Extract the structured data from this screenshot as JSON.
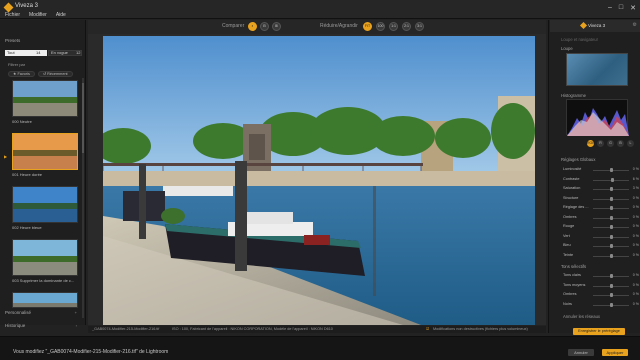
{
  "app": {
    "title": "Viveza 3"
  },
  "menus": [
    "Fichier",
    "Modifier",
    "Aide"
  ],
  "window_controls": {
    "minimize": "–",
    "maximize": "□",
    "close": "✕"
  },
  "left_panel": {
    "presets_title": "Presets",
    "search_value": "Tout",
    "search_count": "14",
    "sort_value": "En vogue",
    "sort_count": "12",
    "filter_label": "Filtrer par",
    "btn_favoris": "★ Favoris",
    "btn_recent": "↺ Récemment",
    "presets": [
      {
        "label": "000 Neutre",
        "sky": "#6fa0cc",
        "bottom": "#8d8a7a"
      },
      {
        "label": "001 Heure dorée",
        "sky": "#e79a4a",
        "bottom": "#c77f4b"
      },
      {
        "label": "002 Heure bleue",
        "sky": "#3f83c8",
        "bottom": "#2a5f93"
      },
      {
        "label": "003 Supprimer la dominante de c...",
        "sky": "#7db6d8",
        "bottom": "#8b8c7e"
      },
      {
        "label": "",
        "sky": "#6aa8d2",
        "bottom": "#7a7b6e"
      }
    ],
    "personnalise": "Personnalisé",
    "historique": "Historique",
    "ajouter": "+",
    "plus": "›"
  },
  "toolbar": {
    "compare_label": "Comparer",
    "resize_label": "Réduire/Agrandir",
    "zoom_fit": "FIT",
    "zoom_100": "100",
    "zoom_1_1": "1:1",
    "zoom_2_1": "2:1",
    "zoom_3_1": "3:1"
  },
  "status": {
    "file": "_GAB0074-Modifier-215-Modifier-216.tif",
    "iso": "ISO : 100, Fabricant de l'appareil : NIKON CORPORATION, Modèle de l'appareil : NIKON D610",
    "nondestructive": "Modifications non destructives (fichiers plus volumineux)"
  },
  "right_panel": {
    "logo": "Viveza 3",
    "loupe_label": "Loupe et navigateur",
    "loupe": "Loupe",
    "histogram": "Histogramme",
    "channels": [
      "RGB",
      "R",
      "G",
      "B",
      "L"
    ],
    "global_label": "Réglages Globaux",
    "sliders_global": [
      {
        "name": "Luminosité",
        "value": "0 %",
        "pos": 0.5
      },
      {
        "name": "Contraste",
        "value": "6 %",
        "pos": 0.55
      },
      {
        "name": "Saturation",
        "value": "3 %",
        "pos": 0.52
      },
      {
        "name": "Structure",
        "value": "0 %",
        "pos": 0.5
      },
      {
        "name": "Réglage des ...",
        "value": "0 %",
        "pos": 0.5
      },
      {
        "name": "Ombres",
        "value": "0 %",
        "pos": 0.5
      },
      {
        "name": "Rouge",
        "value": "0 %",
        "pos": 0.5
      },
      {
        "name": "Vert",
        "value": "0 %",
        "pos": 0.5
      },
      {
        "name": "Bleu",
        "value": "0 %",
        "pos": 0.5
      },
      {
        "name": "Teinte",
        "value": "0 %",
        "pos": 0.5
      }
    ],
    "selective_label": "Tons sélectifs",
    "sliders_selective": [
      {
        "name": "Tons clairs",
        "value": "0 %",
        "pos": 0.5
      },
      {
        "name": "Tons moyens",
        "value": "0 %",
        "pos": 0.5
      },
      {
        "name": "Ombres",
        "value": "0 %",
        "pos": 0.5
      },
      {
        "name": "Noirs",
        "value": "0 %",
        "pos": 0.5
      }
    ],
    "reset_link": "Annuler les réseaux",
    "save_preset": "Enregistrer le préréglage"
  },
  "bottom_bar": {
    "message": "Vous modifiez \"_GAB0074-Modifier-215-Modifier-216.tif\" de Lightroom",
    "cancel": "Annuler",
    "apply": "Appliquer"
  },
  "colors": {
    "accent": "#e9a21e"
  }
}
